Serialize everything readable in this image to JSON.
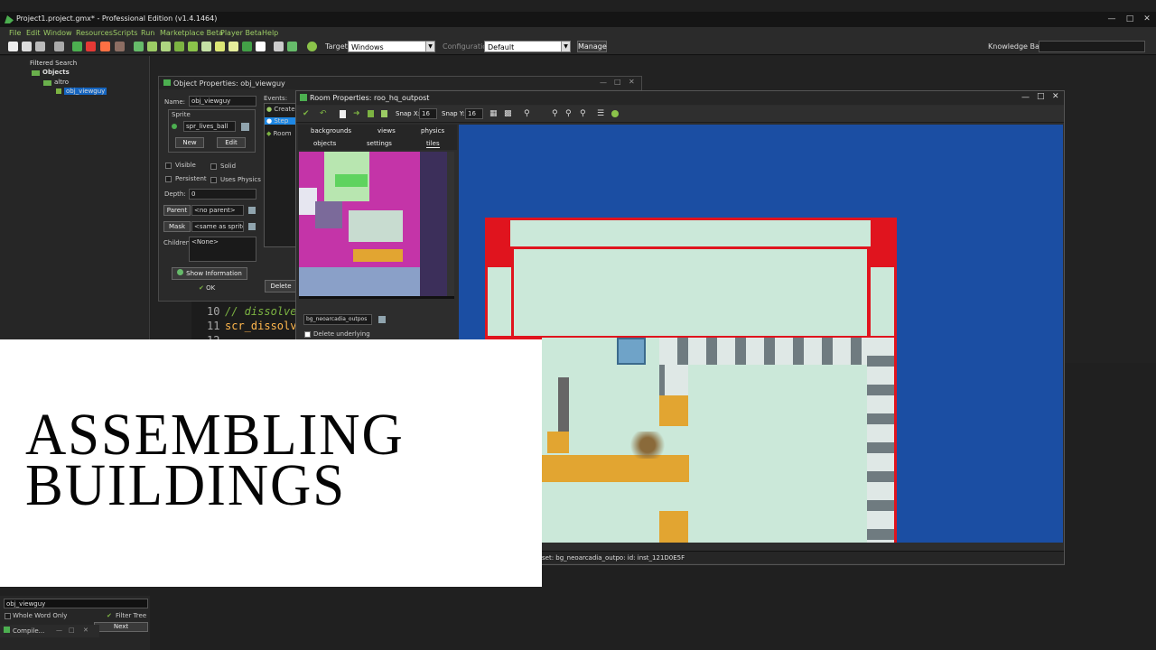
{
  "window": {
    "title": "Project1.project.gmx* - Professional Edition (v1.4.1464)"
  },
  "menu": [
    "File",
    "Edit",
    "Window",
    "Resources",
    "Scripts",
    "Run",
    "Marketplace Beta",
    "Player Beta",
    "Help"
  ],
  "toolbar": {
    "target_label": "Target:",
    "target_value": "Windows",
    "config_label": "Configuration",
    "config_value": "Default",
    "manage_label": "Manage",
    "knowledge_label": "Knowledge Base:"
  },
  "tree": {
    "filtered_search": "Filtered Search",
    "objects": "Objects",
    "folder": "altro",
    "selected": "obj_viewguy"
  },
  "object_window": {
    "title": "Object Properties: obj_viewguy",
    "name_label": "Name:",
    "name_value": "obj_viewguy",
    "sprite_label": "Sprite",
    "sprite_value": "spr_lives_ball",
    "new_label": "New",
    "edit_label": "Edit",
    "visible_label": "Visible",
    "solid_label": "Solid",
    "persistent_label": "Persistent",
    "uses_physics_label": "Uses Physics",
    "depth_label": "Depth:",
    "depth_value": "0",
    "parent_label": "Parent",
    "parent_value": "<no parent>",
    "mask_label": "Mask",
    "mask_value": "<same as sprite>",
    "children_label": "Children:",
    "children_value": "<None>",
    "show_info_label": "Show Information",
    "ok_label": "OK",
    "events_label": "Events:",
    "events": [
      "Create",
      "Step",
      "Room"
    ],
    "delete_label": "Delete"
  },
  "code": {
    "line_numbers": [
      "10",
      "11",
      "12"
    ],
    "lines": [
      "// dissolver",
      "scr_dissolve",
      ""
    ]
  },
  "room_window": {
    "title": "Room Properties: roo_hq_outpost",
    "snap_x_label": "Snap X:",
    "snap_x_value": "16",
    "snap_y_label": "Snap Y:",
    "snap_y_value": "16",
    "tabs_row1": [
      "backgrounds",
      "views",
      "physics"
    ],
    "tabs_row2": [
      "objects",
      "settings",
      "tiles"
    ],
    "tileset_value": "bg_neoarcadia_outpos",
    "delete_underlying_label": "Delete underlying",
    "status_text": "set: bg_neoarcadia_outpo: id: inst_121D0E5F"
  },
  "overlay": {
    "line1": "ASSEMBLING",
    "line2": "BUILDINGS"
  },
  "bottom": {
    "search_value": "obj_viewguy",
    "whole_word_label": "Whole Word Only",
    "filter_tree_label": "Filter Tree",
    "next_label": "Next",
    "compile_label": "Compile..."
  },
  "colors": {
    "accent_green": "#9ccc65",
    "room_background": "#1b4ea3",
    "wall_red": "#e0141e",
    "floor_mint": "#cbe8d9"
  }
}
